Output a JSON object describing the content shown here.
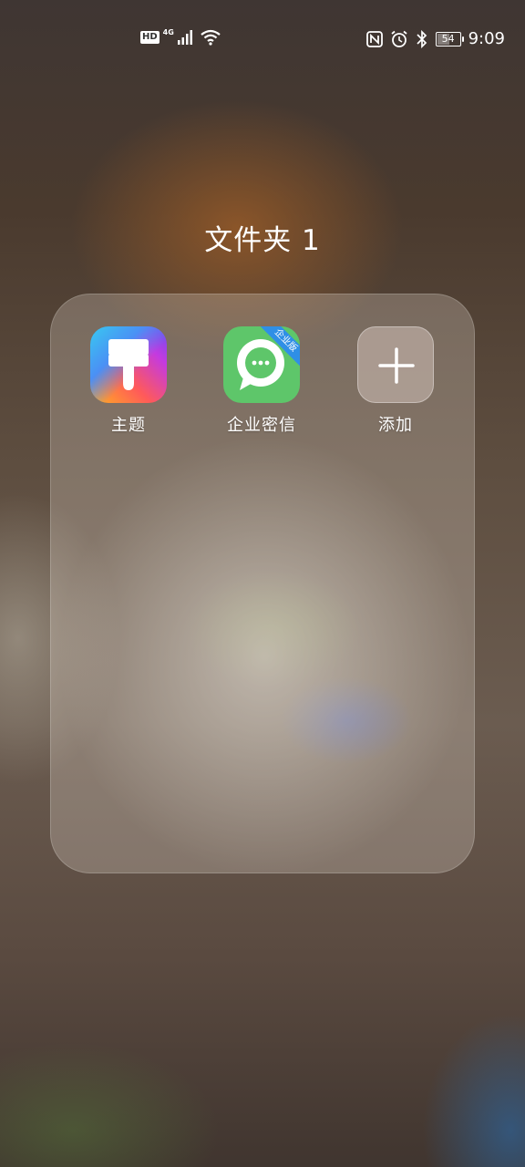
{
  "status_bar": {
    "hd_label": "HD",
    "network_label": "4G",
    "battery_level": "54",
    "time": "9:09",
    "left_icons": [
      "hd-icon",
      "cellular-signal-icon",
      "wifi-icon"
    ],
    "right_icons": [
      "nfc-icon",
      "alarm-icon",
      "bluetooth-icon",
      "battery-icon"
    ]
  },
  "folder": {
    "title": "文件夹 1",
    "apps": [
      {
        "label": "主题",
        "icon": "paintbrush-icon"
      },
      {
        "label": "企业密信",
        "icon": "chat-bubble-icon",
        "badge": "企业版"
      },
      {
        "label": "添加",
        "icon": "plus-icon"
      }
    ]
  },
  "colors": {
    "chat_icon_bg": "#5ec66a",
    "badge_bg": "#2f8fe6"
  }
}
